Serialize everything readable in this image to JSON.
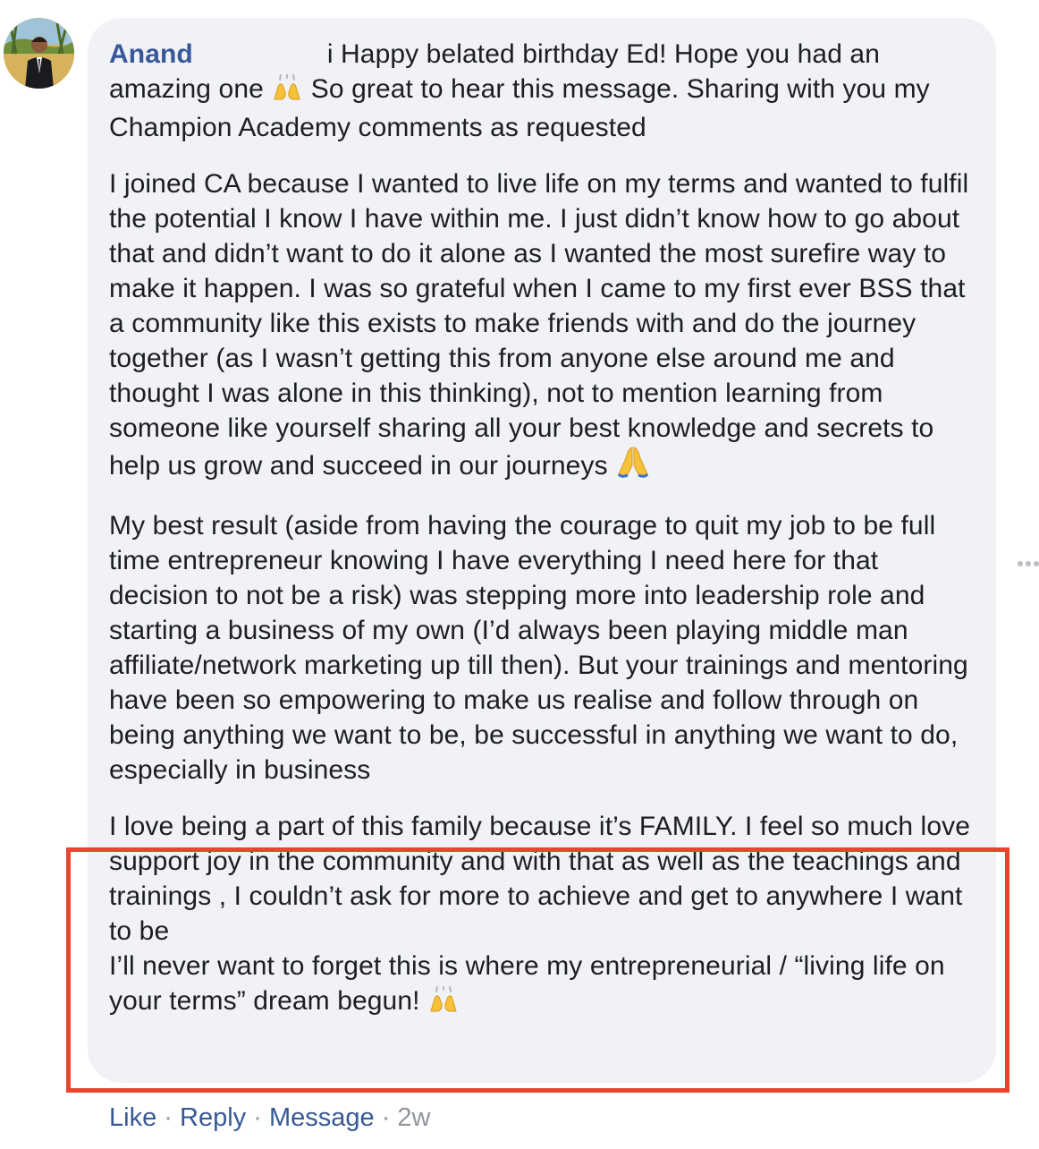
{
  "comment": {
    "author": "Anand",
    "intro_text": "i Happy belated birthday Ed! Hope you had an amazing one",
    "intro_text_2": "So great to hear this message. Sharing with you my Champion Academy comments as requested",
    "paragraph_2": "I joined CA because I wanted to live life on my terms and wanted to fulfil the potential I know I have within me. I just didn’t know how to go about that and didn’t want to do it alone as I wanted the most surefire way to make it happen. I was so grateful when I came to my first ever BSS that a community like this exists to make friends with and do the journey together (as I wasn’t getting this from anyone else around me and thought I was alone in this thinking), not to mention learning from someone like yourself sharing all your best knowledge and secrets to help us grow and succeed in our journeys",
    "paragraph_3": "My best result (aside from having the courage to quit my job to be full time entrepreneur knowing I have everything I need here for that decision to not be a risk) was stepping more into leadership role and starting a business of my own (I’d always been playing middle man affiliate/network marketing up till then). But your trainings and mentoring have been so empowering to make us realise and follow through on being anything we want to be, be successful in anything we want to do, especially in business",
    "paragraph_4_line_1": "I love being a part of this family because it’s FAMILY. I feel so much love support joy in the community and with that as well as the teachings and trainings , I couldn’t ask for more to achieve and get to anywhere I want to be",
    "paragraph_4_line_2": "I’ll never want to forget this is where my entrepreneurial / “living life on your terms” dream begun!"
  },
  "actions": {
    "like": "Like",
    "reply": "Reply",
    "message": "Message",
    "separator": "·",
    "time": "2w"
  },
  "icons": {
    "celebrate": "raising-hands-emoji",
    "pray": "folded-hands-emoji",
    "more": "more-options-icon"
  },
  "colors": {
    "author_link": "#385898",
    "bubble_bg": "#f0f2f5",
    "highlight_border": "#e8452c",
    "meta_gray": "#90949c"
  }
}
